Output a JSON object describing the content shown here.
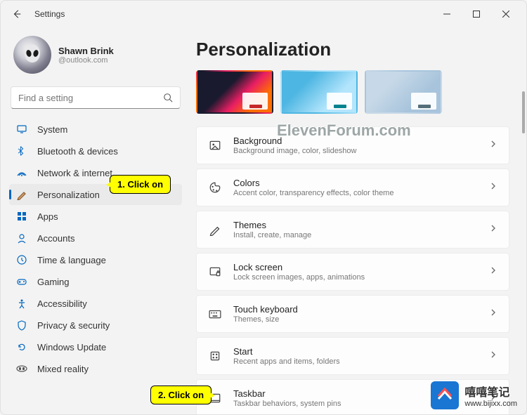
{
  "titlebar": {
    "title": "Settings"
  },
  "profile": {
    "name": "Shawn Brink",
    "email": "@outlook.com"
  },
  "search": {
    "placeholder": "Find a setting"
  },
  "nav": [
    {
      "id": "system",
      "label": "System"
    },
    {
      "id": "bluetooth",
      "label": "Bluetooth & devices"
    },
    {
      "id": "network",
      "label": "Network & internet"
    },
    {
      "id": "personalization",
      "label": "Personalization",
      "selected": true
    },
    {
      "id": "apps",
      "label": "Apps"
    },
    {
      "id": "accounts",
      "label": "Accounts"
    },
    {
      "id": "time",
      "label": "Time & language"
    },
    {
      "id": "gaming",
      "label": "Gaming"
    },
    {
      "id": "accessibility",
      "label": "Accessibility"
    },
    {
      "id": "privacy",
      "label": "Privacy & security"
    },
    {
      "id": "update",
      "label": "Windows Update"
    },
    {
      "id": "mixed",
      "label": "Mixed reality"
    }
  ],
  "page": {
    "title": "Personalization"
  },
  "settings": [
    {
      "id": "background",
      "title": "Background",
      "desc": "Background image, color, slideshow"
    },
    {
      "id": "colors",
      "title": "Colors",
      "desc": "Accent color, transparency effects, color theme"
    },
    {
      "id": "themes",
      "title": "Themes",
      "desc": "Install, create, manage"
    },
    {
      "id": "lockscreen",
      "title": "Lock screen",
      "desc": "Lock screen images, apps, animations"
    },
    {
      "id": "touchkb",
      "title": "Touch keyboard",
      "desc": "Themes, size"
    },
    {
      "id": "start",
      "title": "Start",
      "desc": "Recent apps and items, folders"
    },
    {
      "id": "taskbar",
      "title": "Taskbar",
      "desc": "Taskbar behaviors, system pins"
    }
  ],
  "callouts": {
    "c1": "1. Click on",
    "c2": "2. Click on"
  },
  "watermark": {
    "text": "ElevenForum.com",
    "logo_cn": "嘻嘻笔记",
    "logo_url": "www.bijixx.com"
  }
}
